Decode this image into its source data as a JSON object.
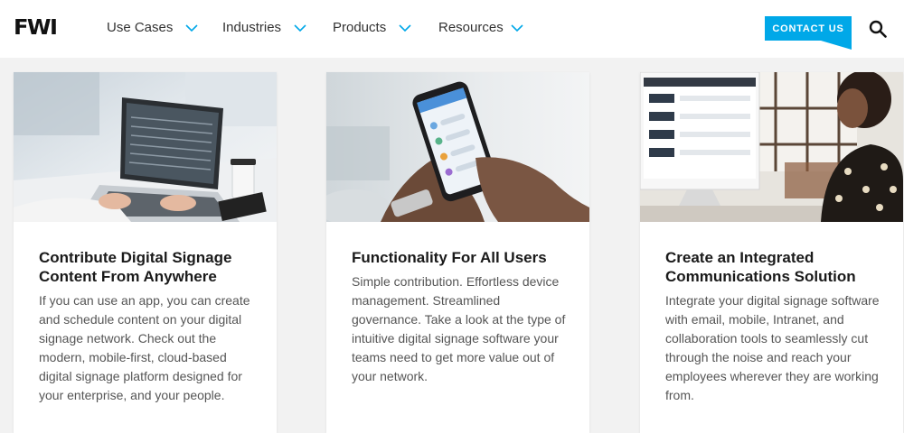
{
  "header": {
    "logo": "FWI",
    "nav": [
      {
        "label": "Use Cases"
      },
      {
        "label": "Industries"
      },
      {
        "label": "Products"
      },
      {
        "label": "Resources"
      }
    ],
    "contact_label": "CONTACT US",
    "accent_color": "#00a8e8"
  },
  "cards": [
    {
      "title": "Contribute Digital Signage Content From Anywhere",
      "body": "If you can use an app, you can create and schedule content on your digital signage network. Check out the modern, mobile-first, cloud-based digital signage platform designed for your enterprise, and your people.",
      "image": "photo of hands typing on a laptop"
    },
    {
      "title": "Functionality For All Users",
      "body": "Simple contribution. Effortless device management. Streamlined governance. Take a look at the type of intuitive digital signage software your teams need to get more value out of your network.",
      "image": "photo of hands holding a smartphone"
    },
    {
      "title": "Create an Integrated Communications Solution",
      "body": "Integrate your digital signage software with email, mobile, Intranet, and collaboration tools to seamlessly cut through the noise and reach your employees wherever they are working from.",
      "image": "photo of woman at a desktop computer"
    }
  ]
}
